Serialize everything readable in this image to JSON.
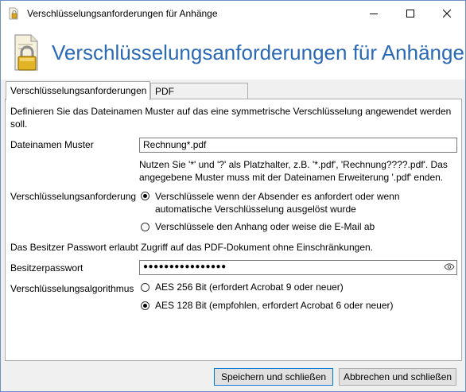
{
  "window": {
    "title": "Verschlüsselungsanforderungen für Anhänge",
    "controls": {
      "minimize": "minimize-icon",
      "maximize": "maximize-icon",
      "close": "close-icon"
    }
  },
  "header": {
    "title": "Verschlüsselungsanforderungen für Anhänge",
    "icon": "document-lock-icon"
  },
  "tabs": [
    {
      "label": "Verschlüsselungsanforderungen",
      "active": true
    },
    {
      "label": "PDF Einschränkungen",
      "active": false
    }
  ],
  "form": {
    "intro": "Definieren Sie das Dateinamen Muster auf das eine symmetrische Verschlüsselung angewendet werden soll.",
    "pattern_label": "Dateinamen Muster",
    "pattern_value": "Rechnung*.pdf",
    "pattern_hint": "Nutzen Sie '*' und '?' als Platzhalter, z.B. '*.pdf', 'Rechnung????.pdf'. Das angegebene Muster muss mit der Dateinamen Erweiterung '.pdf' enden.",
    "requirement_label": "Verschlüsselungsanforderung",
    "requirement_options": [
      {
        "label": "Verschlüssele wenn der Absender es anfordert oder wenn automatische Verschlüsselung ausgelöst wurde",
        "checked": true
      },
      {
        "label": "Verschlüssele den Anhang oder weise die E-Mail ab",
        "checked": false
      }
    ],
    "owner_info": "Das Besitzer Passwort erlaubt Zugriff auf das PDF-Dokument ohne Einschränkungen.",
    "owner_password_label": "Besitzerpasswort",
    "owner_password_value": "●●●●●●●●●●●●●●●●",
    "algorithm_label": "Verschlüsselungsalgorithmus",
    "algorithm_options": [
      {
        "label": "AES 256 Bit (erfordert Acrobat 9 oder neuer)",
        "checked": false
      },
      {
        "label": "AES 128 Bit (empfohlen, erfordert Acrobat 6 oder neuer)",
        "checked": true
      }
    ]
  },
  "buttons": {
    "save": "Speichern und schließen",
    "cancel": "Abbrechen und schließen"
  },
  "colors": {
    "accent": "#2a69b5",
    "default_button_border": "#0078d7"
  }
}
